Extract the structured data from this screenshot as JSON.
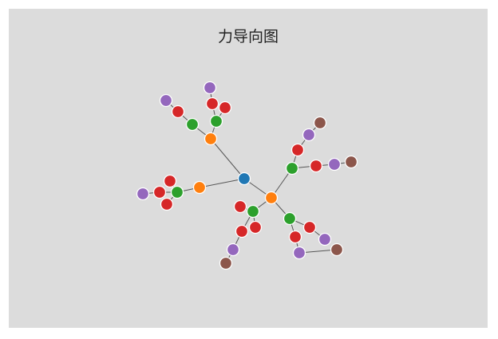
{
  "title": "力导向图",
  "colors": {
    "background": "#dcdcdc",
    "link": "#555555",
    "level0": "#1f77b4",
    "level1": "#ff7f0e",
    "level2": "#2ca02c",
    "level3": "#d62728",
    "level4": "#9467bd",
    "level5": "#8c564b"
  },
  "graph": {
    "nodes": [
      {
        "id": "n0",
        "level": 0
      },
      {
        "id": "n1",
        "level": 1
      },
      {
        "id": "n2",
        "level": 1
      },
      {
        "id": "n3",
        "level": 1
      },
      {
        "id": "n4",
        "level": 2
      },
      {
        "id": "n5",
        "level": 2
      },
      {
        "id": "n6",
        "level": 3
      },
      {
        "id": "n7",
        "level": 4
      },
      {
        "id": "n8",
        "level": 3
      },
      {
        "id": "n9",
        "level": 3
      },
      {
        "id": "n10",
        "level": 4
      },
      {
        "id": "n11",
        "level": 2
      },
      {
        "id": "n12",
        "level": 3
      },
      {
        "id": "n13",
        "level": 3
      },
      {
        "id": "n14",
        "level": 4
      },
      {
        "id": "n15",
        "level": 3
      },
      {
        "id": "n16",
        "level": 2
      },
      {
        "id": "n17",
        "level": 3
      },
      {
        "id": "n18",
        "level": 4
      },
      {
        "id": "n19",
        "level": 5
      },
      {
        "id": "n20",
        "level": 3
      },
      {
        "id": "n21",
        "level": 4
      },
      {
        "id": "n22",
        "level": 5
      },
      {
        "id": "n23",
        "level": 2
      },
      {
        "id": "n24",
        "level": 3
      },
      {
        "id": "n25",
        "level": 3
      },
      {
        "id": "n26",
        "level": 4
      },
      {
        "id": "n27",
        "level": 5
      },
      {
        "id": "n28",
        "level": 3
      },
      {
        "id": "n29",
        "level": 2
      },
      {
        "id": "n30",
        "level": 3
      },
      {
        "id": "n31",
        "level": 4
      },
      {
        "id": "n32",
        "level": 3
      },
      {
        "id": "n33",
        "level": 4
      },
      {
        "id": "n34",
        "level": 5
      }
    ],
    "links": [
      [
        "n0",
        "n1"
      ],
      [
        "n0",
        "n2"
      ],
      [
        "n0",
        "n3"
      ],
      [
        "n1",
        "n4"
      ],
      [
        "n1",
        "n5"
      ],
      [
        "n4",
        "n6"
      ],
      [
        "n6",
        "n7"
      ],
      [
        "n5",
        "n8"
      ],
      [
        "n5",
        "n9"
      ],
      [
        "n9",
        "n10"
      ],
      [
        "n2",
        "n11"
      ],
      [
        "n11",
        "n12"
      ],
      [
        "n11",
        "n13"
      ],
      [
        "n11",
        "n15"
      ],
      [
        "n13",
        "n14"
      ],
      [
        "n3",
        "n16"
      ],
      [
        "n3",
        "n23"
      ],
      [
        "n3",
        "n29"
      ],
      [
        "n16",
        "n17"
      ],
      [
        "n17",
        "n18"
      ],
      [
        "n18",
        "n19"
      ],
      [
        "n16",
        "n20"
      ],
      [
        "n20",
        "n21"
      ],
      [
        "n21",
        "n22"
      ],
      [
        "n23",
        "n24"
      ],
      [
        "n23",
        "n25"
      ],
      [
        "n25",
        "n26"
      ],
      [
        "n26",
        "n27"
      ],
      [
        "n23",
        "n28"
      ],
      [
        "n29",
        "n30"
      ],
      [
        "n29",
        "n32"
      ],
      [
        "n30",
        "n31"
      ],
      [
        "n32",
        "n33"
      ],
      [
        "n33",
        "n34"
      ]
    ]
  }
}
